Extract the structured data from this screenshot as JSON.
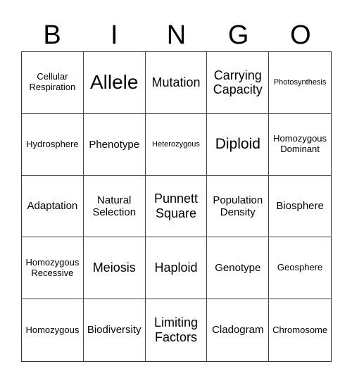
{
  "header": [
    "B",
    "I",
    "N",
    "G",
    "O"
  ],
  "cells": [
    "Cellular Respiration",
    "Allele",
    "Mutation",
    "Carrying Capacity",
    "Photosynthesis",
    "Hydrosphere",
    "Phenotype",
    "Heterozygous",
    "Diploid",
    "Homozygous Dominant",
    "Adaptation",
    "Natural Selection",
    "Punnett Square",
    "Population Density",
    "Biosphere",
    "Homozygous Recessive",
    "Meiosis",
    "Haploid",
    "Genotype",
    "Geosphere",
    "Homozygous",
    "Biodiversity",
    "Limiting Factors",
    "Cladogram",
    "Chromosome"
  ]
}
